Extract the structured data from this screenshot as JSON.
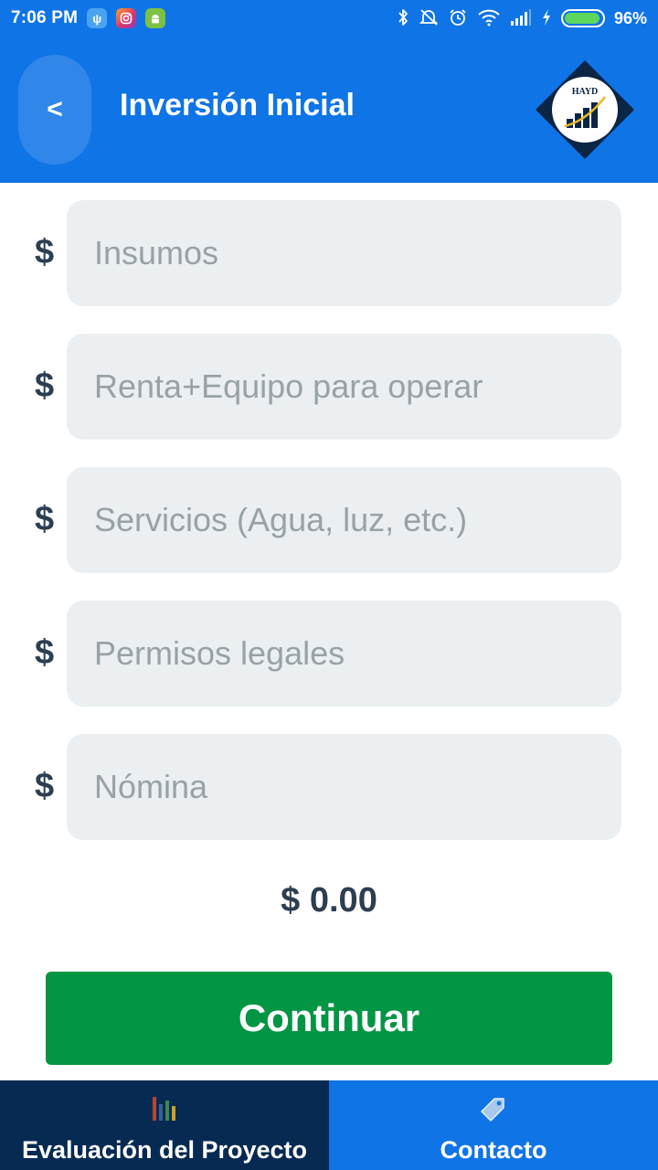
{
  "status_bar": {
    "time": "7:06 PM",
    "notifications": [
      "usb-icon",
      "instagram-icon",
      "android-icon"
    ],
    "system_icons": [
      "bluetooth-icon",
      "mute-icon",
      "alarm-icon",
      "wifi-icon",
      "signal-icon",
      "charging-icon",
      "battery-icon"
    ],
    "battery_percent": "96%",
    "battery_level": 0.96
  },
  "header": {
    "back_label": "<",
    "title": "Inversión Inicial",
    "logo_text": "HAYD"
  },
  "form": {
    "currency_symbol": "$",
    "fields": [
      {
        "placeholder": "Insumos",
        "value": ""
      },
      {
        "placeholder": "Renta+Equipo para operar",
        "value": ""
      },
      {
        "placeholder": "Servicios (Agua, luz, etc.)",
        "value": ""
      },
      {
        "placeholder": "Permisos legales",
        "value": ""
      },
      {
        "placeholder": "Nómina",
        "value": ""
      }
    ],
    "total": "$ 0.00",
    "continue_label": "Continuar"
  },
  "tabs": [
    {
      "label": "Evaluación del Proyecto",
      "icon": "bar-chart-icon",
      "active": false
    },
    {
      "label": "Contacto",
      "icon": "tag-icon",
      "active": true
    }
  ],
  "colors": {
    "primary": "#0f74e6",
    "dark_navy": "#062a52",
    "success": "#029544",
    "input_bg": "#ebeff1",
    "text_dark": "#2c3e50",
    "placeholder": "#98a2a6"
  }
}
